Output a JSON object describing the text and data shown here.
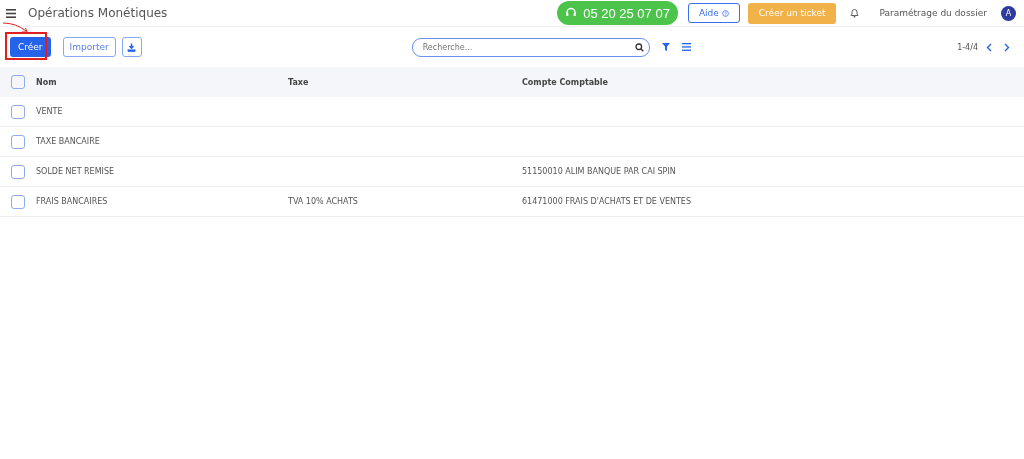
{
  "header": {
    "title": "Opérations Monétiques",
    "phone": "05 20 25 07 07",
    "help": "Aide",
    "ticket": "Créer un ticket",
    "settings": "Paramétrage du dossier",
    "avatar": "A"
  },
  "toolbar": {
    "create": "Créer",
    "import": "Importer",
    "search": {
      "placeholder": "Recherche..."
    },
    "pager": "1-4/4"
  },
  "table": {
    "all_checked": false,
    "columns": [
      "Nom",
      "Taxe",
      "Compte Comptable"
    ],
    "rows": [
      {
        "checked": false,
        "cells": [
          "VENTE",
          "",
          ""
        ]
      },
      {
        "checked": false,
        "cells": [
          "TAXE BANCAIRE",
          "",
          ""
        ]
      },
      {
        "checked": false,
        "cells": [
          "SOLDE NET REMISE",
          "",
          "51150010 ALIM BANQUE PAR CAI SPIN"
        ]
      },
      {
        "checked": false,
        "cells": [
          "FRAIS BANCAIRES",
          "TVA 10% ACHATS",
          "61471000 FRAIS D'ACHATS ET DE VENTES"
        ]
      }
    ]
  }
}
